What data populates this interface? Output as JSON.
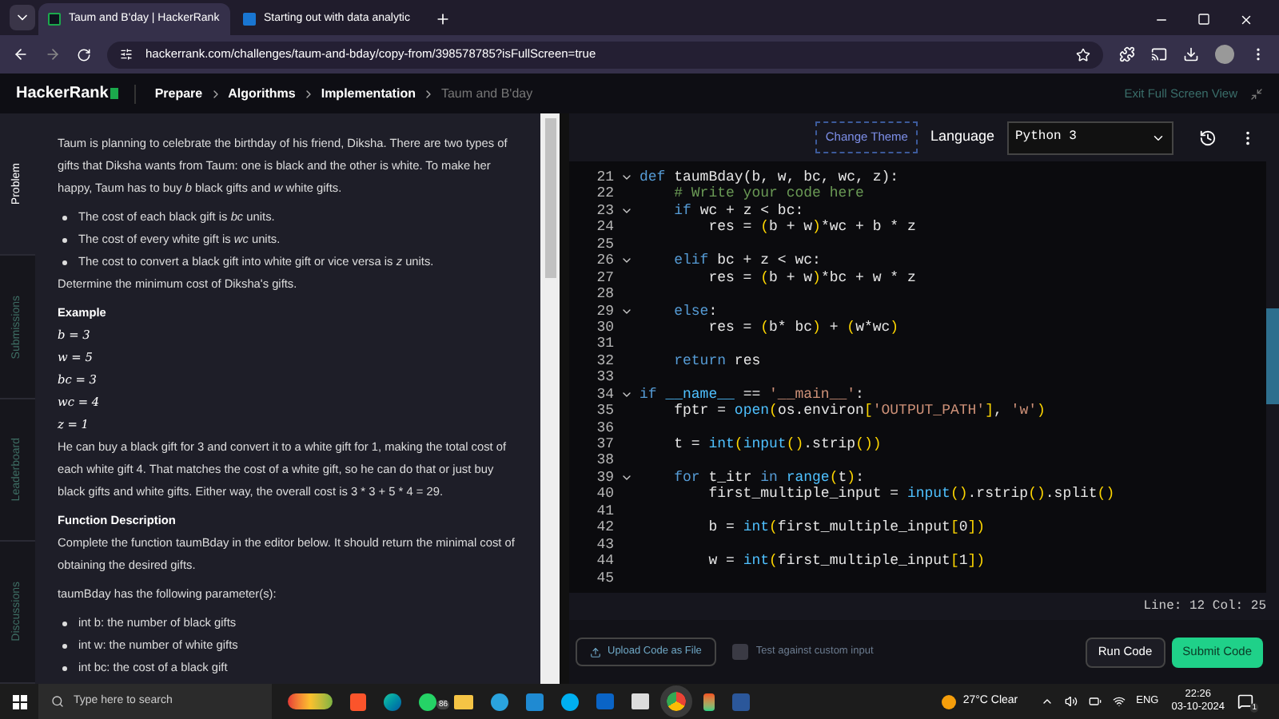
{
  "browser": {
    "tabs": [
      {
        "label": "Taum and B'day | HackerRank",
        "selected": true
      },
      {
        "label": "Starting out with data analytic",
        "selected": false
      }
    ],
    "url": "hackerrank.com/challenges/taum-and-bday/copy-from/398578785?isFullScreen=true"
  },
  "header": {
    "logo": "HackerRank",
    "breadcrumbs": [
      "Prepare",
      "Algorithms",
      "Implementation",
      "Taum and B'day"
    ],
    "exit": "Exit Full Screen View"
  },
  "side_tabs": [
    {
      "label": "Problem",
      "selected": true
    },
    {
      "label": "Submissions",
      "selected": false
    },
    {
      "label": "Leaderboard",
      "selected": false
    },
    {
      "label": "Discussions",
      "selected": false
    }
  ],
  "problem": [
    {
      "kind": "p",
      "text": "Taum is planning to celebrate the birthday of his friend, Diksha. There are two types of gifts that Diksha wants from Taum: one is black and the other is white. To make her happy, Taum has to buy *b* black gifts and *w* white gifts."
    },
    {
      "kind": "li",
      "text": "The cost of each black gift is *bc* units."
    },
    {
      "kind": "li",
      "text": "The cost of every white gift is *wc* units."
    },
    {
      "kind": "li",
      "text": "The cost to convert a black gift into white gift or vice versa is *z* units."
    },
    {
      "kind": "p",
      "text": "Determine the minimum cost of Diksha's gifts."
    },
    {
      "kind": "h",
      "text": "Example"
    },
    {
      "kind": "math",
      "text": "b = 3"
    },
    {
      "kind": "math",
      "text": "w = 5"
    },
    {
      "kind": "math",
      "text": "bc = 3"
    },
    {
      "kind": "math",
      "text": "wc = 4"
    },
    {
      "kind": "math",
      "text": "z = 1"
    },
    {
      "kind": "p",
      "text": "He can buy a black gift for 3 and convert it to a white gift for 1, making the total cost of each white gift 4. That matches the cost of a white gift, so he can do that or just buy black gifts and white gifts. Either way, the overall cost is 3 * 3 + 5 * 4 = 29."
    },
    {
      "kind": "h",
      "text": "Function Description"
    },
    {
      "kind": "p",
      "text": "Complete the function taumBday in the editor below. It should return the minimal cost of obtaining the desired gifts."
    },
    {
      "kind": "p",
      "text": "taumBday has the following parameter(s):"
    },
    {
      "kind": "li",
      "text": "int b: the number of black gifts"
    },
    {
      "kind": "li",
      "text": "int w: the number of white gifts"
    },
    {
      "kind": "li",
      "text": "int bc: the cost of a black gift"
    }
  ],
  "editor": {
    "theme_button": "Change Theme",
    "language_label": "Language",
    "language": "Python 3",
    "lines": [
      {
        "number": "21",
        "fold": true,
        "tokens": [
          {
            "kind": "kw",
            "text": "def "
          },
          {
            "kind": "tx",
            "text": "taumBday(b, w, bc, wc, z):"
          }
        ]
      },
      {
        "number": "22",
        "fold": false,
        "tokens": [
          {
            "kind": "cm",
            "text": "    # Write your code here"
          }
        ]
      },
      {
        "number": "23",
        "fold": true,
        "tokens": [
          {
            "kind": "kw",
            "text": "    if "
          },
          {
            "kind": "tx",
            "text": "wc + z < bc:"
          }
        ]
      },
      {
        "number": "24",
        "fold": false,
        "tokens": [
          {
            "kind": "tx",
            "text": "        res = "
          },
          {
            "kind": "br",
            "text": "("
          },
          {
            "kind": "tx",
            "text": "b + w"
          },
          {
            "kind": "br",
            "text": ")"
          },
          {
            "kind": "tx",
            "text": "*wc + b * z"
          }
        ]
      },
      {
        "number": "25",
        "fold": false
      },
      {
        "number": "26",
        "fold": true,
        "tokens": [
          {
            "kind": "kw",
            "text": "    elif "
          },
          {
            "kind": "tx",
            "text": "bc + z < wc:"
          }
        ]
      },
      {
        "number": "27",
        "fold": false,
        "tokens": [
          {
            "kind": "tx",
            "text": "        res = "
          },
          {
            "kind": "br",
            "text": "("
          },
          {
            "kind": "tx",
            "text": "b + w"
          },
          {
            "kind": "br",
            "text": ")"
          },
          {
            "kind": "tx",
            "text": "*bc + w * z"
          }
        ]
      },
      {
        "number": "28",
        "fold": false
      },
      {
        "number": "29",
        "fold": true,
        "tokens": [
          {
            "kind": "kw",
            "text": "    else"
          },
          {
            "kind": "tx",
            "text": ":"
          }
        ]
      },
      {
        "number": "30",
        "fold": false,
        "tokens": [
          {
            "kind": "tx",
            "text": "        res = "
          },
          {
            "kind": "br",
            "text": "("
          },
          {
            "kind": "tx",
            "text": "b* bc"
          },
          {
            "kind": "br",
            "text": ")"
          },
          {
            "kind": "tx",
            "text": " + "
          },
          {
            "kind": "br",
            "text": "("
          },
          {
            "kind": "tx",
            "text": "w*wc"
          },
          {
            "kind": "br",
            "text": ")"
          }
        ]
      },
      {
        "number": "31",
        "fold": false
      },
      {
        "number": "32",
        "fold": false,
        "tokens": [
          {
            "kind": "kw",
            "text": "    return "
          },
          {
            "kind": "tx",
            "text": "res"
          }
        ]
      },
      {
        "number": "33",
        "fold": false
      },
      {
        "number": "34",
        "fold": true,
        "tokens": [
          {
            "kind": "kw",
            "text": "if "
          },
          {
            "kind": "fn",
            "text": "__name__"
          },
          {
            "kind": "tx",
            "text": " == "
          },
          {
            "kind": "str",
            "text": "'__main__'"
          },
          {
            "kind": "tx",
            "text": ":"
          }
        ]
      },
      {
        "number": "35",
        "fold": false,
        "tokens": [
          {
            "kind": "tx",
            "text": "    fptr = "
          },
          {
            "kind": "fn",
            "text": "open"
          },
          {
            "kind": "br",
            "text": "("
          },
          {
            "kind": "tx",
            "text": "os.environ"
          },
          {
            "kind": "br",
            "text": "["
          },
          {
            "kind": "str",
            "text": "'OUTPUT_PATH'"
          },
          {
            "kind": "br",
            "text": "]"
          },
          {
            "kind": "tx",
            "text": ", "
          },
          {
            "kind": "str",
            "text": "'w'"
          },
          {
            "kind": "br",
            "text": ")"
          }
        ]
      },
      {
        "number": "36",
        "fold": false
      },
      {
        "number": "37",
        "fold": false,
        "tokens": [
          {
            "kind": "tx",
            "text": "    t = "
          },
          {
            "kind": "fn",
            "text": "int"
          },
          {
            "kind": "br",
            "text": "("
          },
          {
            "kind": "fn",
            "text": "input"
          },
          {
            "kind": "br",
            "text": "()"
          },
          {
            "kind": "tx",
            "text": ".strip"
          },
          {
            "kind": "br",
            "text": "())"
          }
        ]
      },
      {
        "number": "38",
        "fold": false
      },
      {
        "number": "39",
        "fold": true,
        "tokens": [
          {
            "kind": "kw",
            "text": "    for "
          },
          {
            "kind": "tx",
            "text": "t_itr "
          },
          {
            "kind": "kw",
            "text": "in "
          },
          {
            "kind": "fn",
            "text": "range"
          },
          {
            "kind": "br",
            "text": "("
          },
          {
            "kind": "tx",
            "text": "t"
          },
          {
            "kind": "br",
            "text": ")"
          },
          {
            "kind": "tx",
            "text": ":"
          }
        ]
      },
      {
        "number": "40",
        "fold": false,
        "tokens": [
          {
            "kind": "tx",
            "text": "        first_multiple_input = "
          },
          {
            "kind": "fn",
            "text": "input"
          },
          {
            "kind": "br",
            "text": "()"
          },
          {
            "kind": "tx",
            "text": ".rstrip"
          },
          {
            "kind": "br",
            "text": "()"
          },
          {
            "kind": "tx",
            "text": ".split"
          },
          {
            "kind": "br",
            "text": "()"
          }
        ]
      },
      {
        "number": "41",
        "fold": false
      },
      {
        "number": "42",
        "fold": false,
        "tokens": [
          {
            "kind": "tx",
            "text": "        b = "
          },
          {
            "kind": "fn",
            "text": "int"
          },
          {
            "kind": "br",
            "text": "("
          },
          {
            "kind": "tx",
            "text": "first_multiple_input"
          },
          {
            "kind": "br",
            "text": "["
          },
          {
            "kind": "tx",
            "text": "0"
          },
          {
            "kind": "br",
            "text": "])"
          }
        ]
      },
      {
        "number": "43",
        "fold": false
      },
      {
        "number": "44",
        "fold": false,
        "tokens": [
          {
            "kind": "tx",
            "text": "        w = "
          },
          {
            "kind": "fn",
            "text": "int"
          },
          {
            "kind": "br",
            "text": "("
          },
          {
            "kind": "tx",
            "text": "first_multiple_input"
          },
          {
            "kind": "br",
            "text": "["
          },
          {
            "kind": "tx",
            "text": "1"
          },
          {
            "kind": "br",
            "text": "])"
          }
        ]
      },
      {
        "number": "45",
        "fold": false
      }
    ],
    "status": "Line: 12 Col: 25",
    "upload": "Upload Code as File",
    "custom_input": {
      "label": "Test against custom input",
      "checked": false
    },
    "run": "Run Code",
    "submit": "Submit Code"
  },
  "taskbar": {
    "search_placeholder": "Type here to search",
    "whatsapp_badge": "86",
    "weather": "27°C Clear",
    "lang": "ENG",
    "time": "22:26",
    "date": "03-10-2024",
    "notifications": "1"
  }
}
